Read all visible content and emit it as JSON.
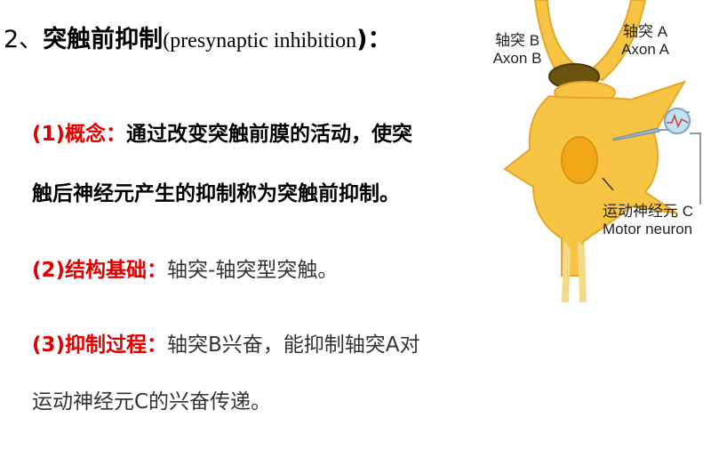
{
  "title": {
    "number": "2、",
    "main": "突触前抑制",
    "paren_open": "(",
    "english": "presynaptic inhibition",
    "paren_close": ")",
    "colon": "："
  },
  "points": [
    {
      "label": "(1)概念：",
      "text_line1": "通过改变突触前膜的活动，使突",
      "text_line2": "触后神经元产生的抑制称为突触前抑制。"
    },
    {
      "label": "(2)结构基础：",
      "text": "轴突-轴突型突触。"
    },
    {
      "label": "(3)抑制过程：",
      "text_line1": "轴突B兴奋，能抑制轴突A对",
      "text_line2": "运动神经元C的兴奋传递。"
    }
  ],
  "diagram": {
    "axon_b_cn": "轴突 B",
    "axon_b_en": "Axon B",
    "axon_a_cn": "轴突 A",
    "axon_a_en": "Axon A",
    "motor_cn": "运动神经元 C",
    "motor_en": "Motor neuron",
    "colors": {
      "neuron": "#f7c443",
      "neuron_light": "#fde7a0",
      "nucleus": "#f0a818",
      "electrode": "#9ab7c9"
    }
  }
}
